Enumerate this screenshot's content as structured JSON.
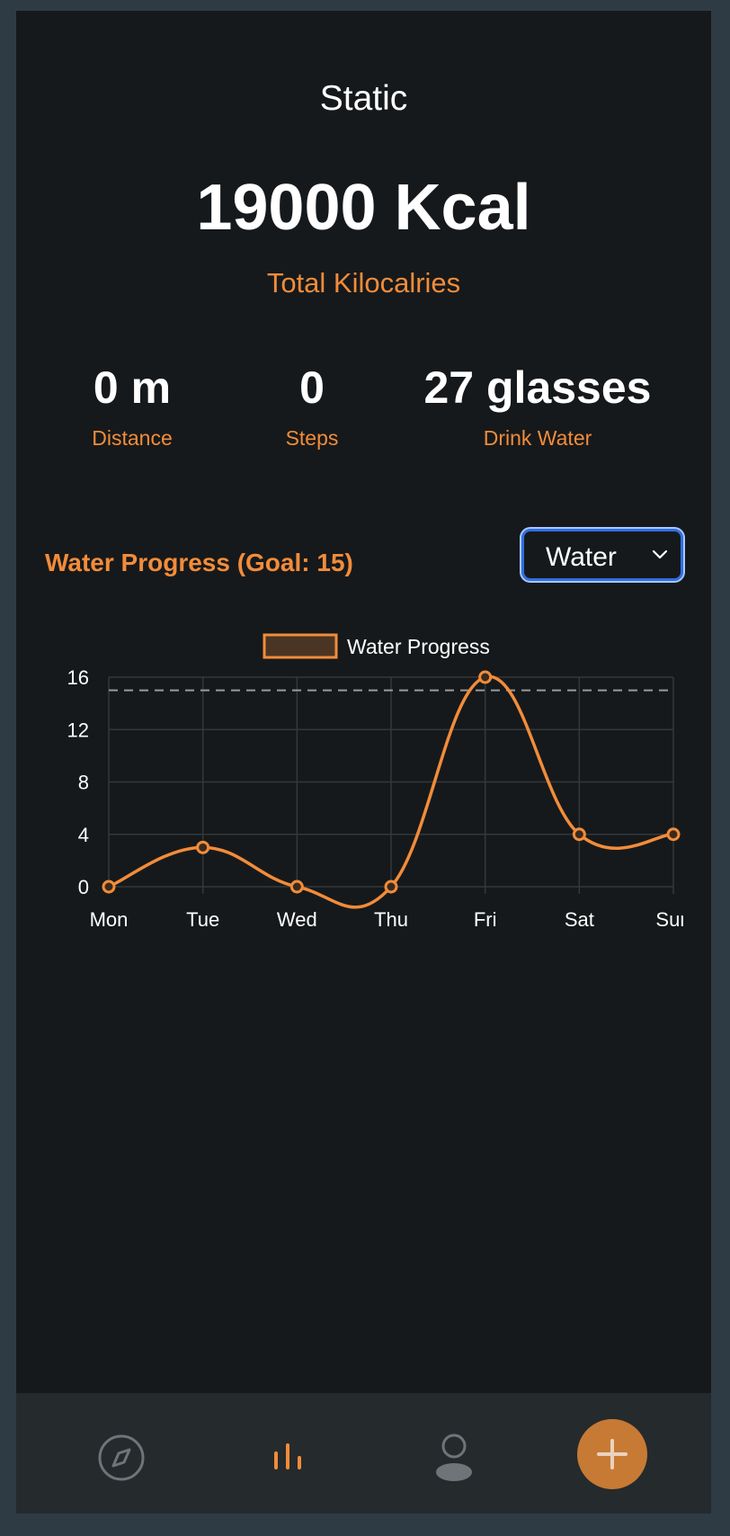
{
  "header": {
    "title": "Static"
  },
  "summary": {
    "total_value": "19000 Kcal",
    "total_label": "Total Kilocalries"
  },
  "stats": [
    {
      "value": "0 m",
      "label": "Distance"
    },
    {
      "value": "0",
      "label": "Steps"
    },
    {
      "value": "27 glasses",
      "label": "Drink Water"
    }
  ],
  "progress": {
    "title": "Water Progress (Goal: 15)",
    "selected_metric": "Water"
  },
  "chart_data": {
    "type": "line",
    "categories": [
      "Mon",
      "Tue",
      "Wed",
      "Thu",
      "Fri",
      "Sat",
      "Sun"
    ],
    "series": [
      {
        "name": "Water Progress",
        "values": [
          0,
          3,
          0,
          0,
          16,
          4,
          4
        ],
        "color": "#f28c3a"
      }
    ],
    "goal": 15,
    "ylim": [
      0,
      16
    ],
    "yticks": [
      "0",
      "4",
      "8",
      "12",
      "16"
    ],
    "legend": "top",
    "grid": true
  },
  "nav": {
    "items": [
      {
        "icon": "compass-icon"
      },
      {
        "icon": "bar-chart-icon"
      },
      {
        "icon": "person-icon"
      },
      {
        "icon": "plus-icon"
      }
    ]
  },
  "colors": {
    "accent": "#f28c3a",
    "background": "#16191b",
    "tabbar": "#252a2d",
    "add_button": "#c77a33"
  }
}
